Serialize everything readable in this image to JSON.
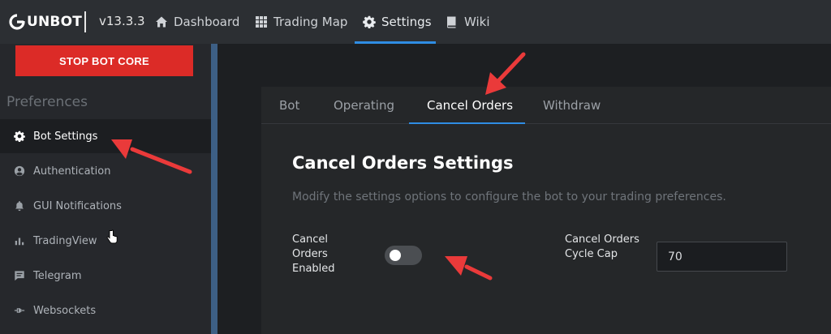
{
  "brand": {
    "name": "UNBOT",
    "version": "v13.3.3"
  },
  "nav": [
    {
      "label": "Dashboard",
      "icon": "home-icon"
    },
    {
      "label": "Trading Map",
      "icon": "grid-icon"
    },
    {
      "label": "Settings",
      "icon": "gear-icon",
      "active": true
    },
    {
      "label": "Wiki",
      "icon": "book-icon"
    }
  ],
  "sidebar": {
    "stop_button": "STOP BOT CORE",
    "section_title": "Preferences",
    "items": [
      {
        "label": "Bot Settings",
        "icon": "gear-icon",
        "active": true
      },
      {
        "label": "Authentication",
        "icon": "user-circle-icon"
      },
      {
        "label": "GUI Notifications",
        "icon": "bell-icon"
      },
      {
        "label": "TradingView",
        "icon": "bar-chart-icon"
      },
      {
        "label": "Telegram",
        "icon": "message-icon"
      },
      {
        "label": "Websockets",
        "icon": "plug-icon"
      }
    ]
  },
  "tabs": [
    {
      "label": "Bot"
    },
    {
      "label": "Operating"
    },
    {
      "label": "Cancel Orders",
      "active": true
    },
    {
      "label": "Withdraw"
    }
  ],
  "settings": {
    "title": "Cancel Orders Settings",
    "description": "Modify the settings options to configure the bot to your trading preferences.",
    "cancel_orders_enabled": {
      "label": "Cancel Orders Enabled",
      "value": false
    },
    "cycle_cap": {
      "label": "Cancel Orders Cycle Cap",
      "value": "70"
    }
  },
  "colors": {
    "accent": "#2f8de4",
    "danger": "#dc2b27",
    "annotation": "#ea3a3a"
  }
}
